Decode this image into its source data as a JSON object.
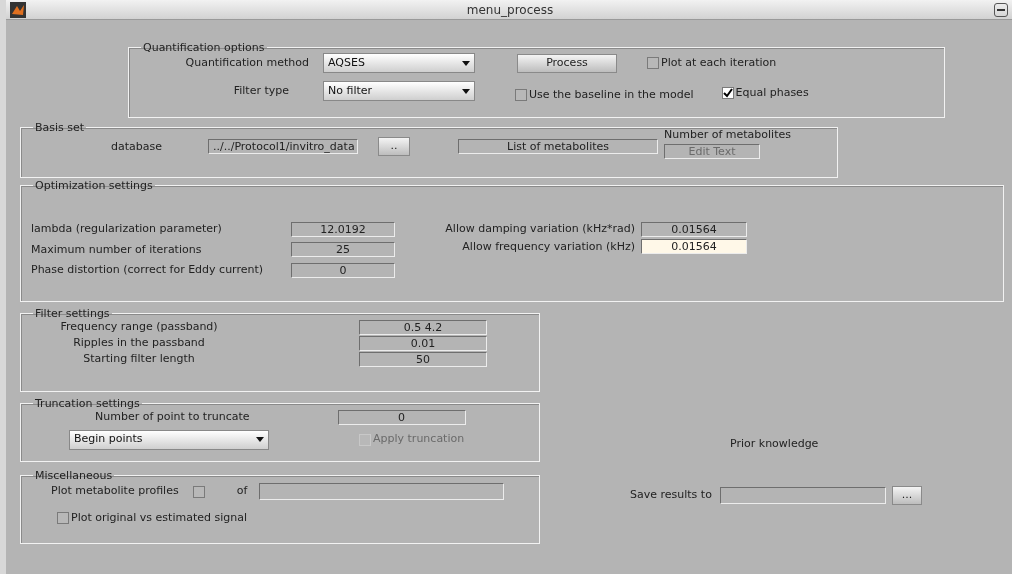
{
  "window": {
    "title": "menu_process"
  },
  "quantification_options": {
    "title": "Quantification options",
    "method": {
      "label": "Quantification method",
      "value": "AQSES"
    },
    "process_button": "Process",
    "plot_each_iteration": {
      "label": "Plot at each iteration",
      "checked": false
    },
    "filter_type": {
      "label": "Filter type",
      "value": "No filter"
    },
    "use_baseline": {
      "label": "Use the baseline in the model",
      "checked": false
    },
    "equal_phases": {
      "label": "Equal phases",
      "checked": true
    }
  },
  "basis_set": {
    "title": "Basis set",
    "database_label": "database",
    "database_value": "../../Protocol1/invitro_data",
    "browse_button": "..",
    "list_field": "List of metabolites",
    "count_label": "Number of metabolites",
    "count_field": "Edit Text"
  },
  "optimization_settings": {
    "title": "Optimization settings",
    "left": [
      {
        "label": "lambda (regularization parameter)",
        "value": "12.0192"
      },
      {
        "label": "Maximum number of iterations",
        "value": "25"
      },
      {
        "label": "Phase distortion (correct for Eddy current)",
        "value": "0"
      }
    ],
    "right": [
      {
        "label": "Allow damping variation (kHz*rad)",
        "value": "0.01564",
        "focused": false
      },
      {
        "label": "Allow frequency variation (kHz)",
        "value": "0.01564",
        "focused": true
      }
    ]
  },
  "filter_settings": {
    "title": "Filter settings",
    "rows": [
      {
        "label": "Frequency range (passband)",
        "value": "0.5 4.2"
      },
      {
        "label": "Ripples in the passband",
        "value": "0.01"
      },
      {
        "label": "Starting filter length",
        "value": "50"
      }
    ]
  },
  "truncation_settings": {
    "title": "Truncation settings",
    "points_label": "Number of point to truncate",
    "points_value": "0",
    "mode": "Begin points",
    "apply": {
      "label": "Apply truncation",
      "checked": false,
      "disabled": true
    }
  },
  "miscellaneous": {
    "title": "Miscellaneous",
    "plot_profiles": {
      "label": "Plot metabolite profiles",
      "checked": false
    },
    "of_label": "of",
    "plot_original": {
      "label": "Plot original vs estimated signal",
      "checked": false
    }
  },
  "prior_knowledge": "Prior knowledge",
  "save_results": {
    "label": "Save results to",
    "browse_button": "..."
  }
}
